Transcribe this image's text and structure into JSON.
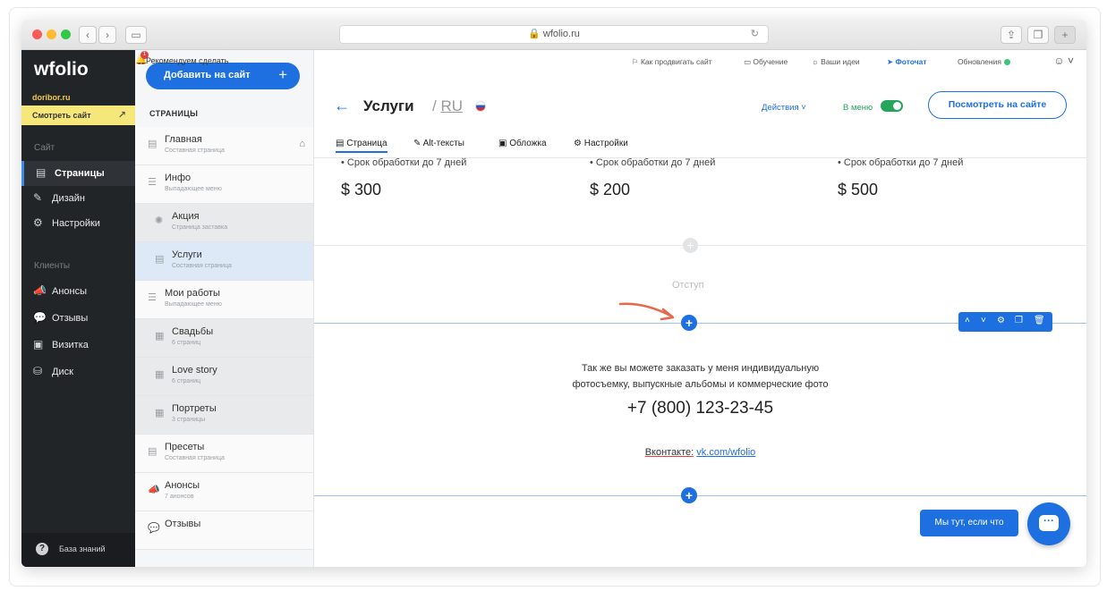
{
  "browser": {
    "url": "wfolio.ru"
  },
  "sidebar": {
    "logo": "wfolio",
    "domain": "doribor.ru",
    "view_site": "Смотреть сайт",
    "section_site": "Сайт",
    "section_clients": "Клиенты",
    "items_site": [
      {
        "label": "Страницы",
        "icon": "page-icon"
      },
      {
        "label": "Дизайн",
        "icon": "brush-icon"
      },
      {
        "label": "Настройки",
        "icon": "gear-icon"
      }
    ],
    "items_clients": [
      {
        "label": "Анонсы",
        "icon": "megaphone-icon"
      },
      {
        "label": "Отзывы",
        "icon": "chat-icon"
      },
      {
        "label": "Визитка",
        "icon": "card-icon"
      },
      {
        "label": "Диск",
        "icon": "disk-icon"
      }
    ],
    "knowledge_base": "База знаний"
  },
  "pages_panel": {
    "add_button": "Добавить на сайт",
    "title": "СТРАНИЦЫ",
    "rows": [
      {
        "name": "Главная",
        "sub": "Составная страница"
      },
      {
        "name": "Инфо",
        "sub": "Выпадающее меню"
      },
      {
        "name": "Акция",
        "sub": "Страница заставка"
      },
      {
        "name": "Услуги",
        "sub": "Составная страница"
      },
      {
        "name": "Мои работы",
        "sub": "Выпадающее меню"
      },
      {
        "name": "Свадьбы",
        "sub": "6 страниц"
      },
      {
        "name": "Love story",
        "sub": "6 страниц"
      },
      {
        "name": "Портреты",
        "sub": "3 страницы"
      },
      {
        "name": "Пресеты",
        "sub": "Составная страница"
      },
      {
        "name": "Анонсы",
        "sub": "7 анонсов"
      },
      {
        "name": "Отзывы",
        "sub": ""
      }
    ]
  },
  "topbar": {
    "recommend": "Рекомендуем сделать",
    "notification_count": "1",
    "links": [
      "Как продвигать сайт",
      "Обучение",
      "Ваши идеи",
      "Фоточат",
      "Обновления"
    ]
  },
  "header": {
    "title": "Услуги",
    "lang": "RU",
    "actions": "Действия",
    "in_menu": "В меню",
    "view_button": "Посмотреть на сайте"
  },
  "tabs": [
    "Страница",
    "Alt-тексты",
    "Обложка",
    "Настройки"
  ],
  "content": {
    "bullets": [
      "• Срок обработки до 7 дней",
      "• Срок обработки до 7 дней",
      "• Срок обработки до 7 дней"
    ],
    "prices": [
      "$ 300",
      "$ 200",
      "$ 500"
    ],
    "spacer_label": "Отступ",
    "text_line1": "Так же вы можете заказать у меня индивидуальную",
    "text_line2": "фотосъемку, выпускные альбомы и коммерческие фото",
    "phone": "+7 (800) 123-23-45",
    "vk_label": "Вконтакте:",
    "vk_link": "vk.com/wfolio"
  },
  "chat": {
    "label": "Мы тут, если что"
  },
  "colors": {
    "accent": "#1e6fe0",
    "sidebar": "#222528",
    "highlight": "#f5e77a",
    "toggle_on": "#27a55a"
  }
}
